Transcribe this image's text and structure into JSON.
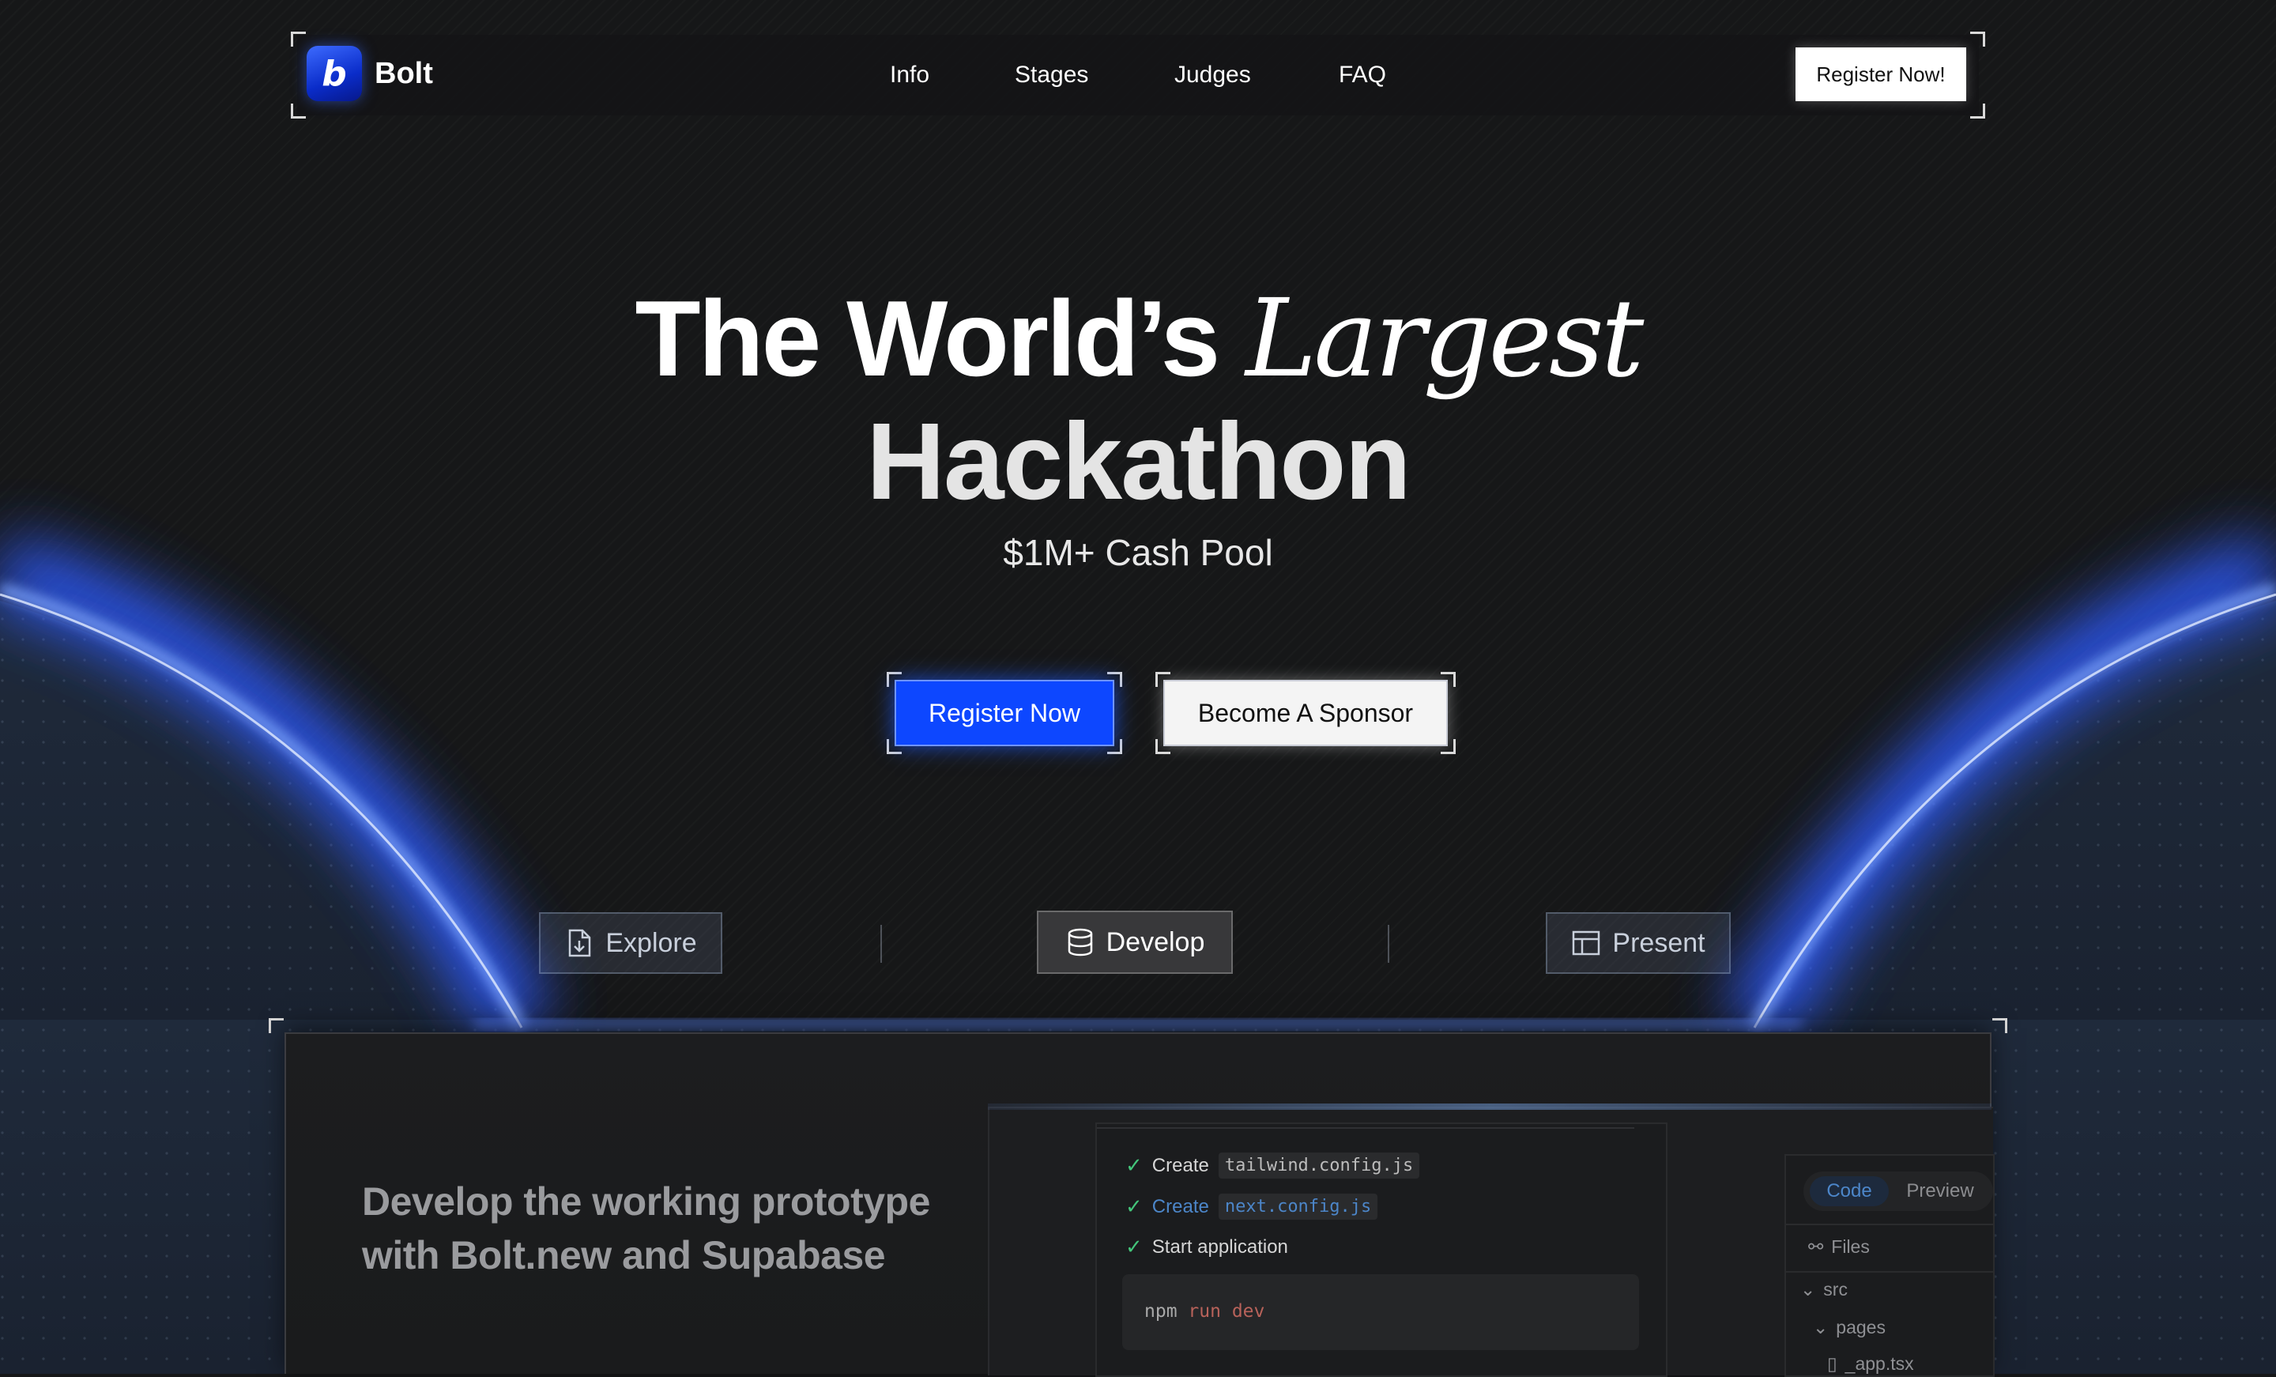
{
  "nav": {
    "brand": "Bolt",
    "logo_letter": "b",
    "links": [
      "Info",
      "Stages",
      "Judges",
      "FAQ"
    ],
    "cta": "Register Now!"
  },
  "hero": {
    "title_prefix": "The World’s",
    "title_italic": "Largest",
    "title_line2": "Hackathon",
    "subtitle": "$1M+ Cash Pool",
    "primary_button": "Register Now",
    "secondary_button": "Become A Sponsor"
  },
  "tabs": [
    {
      "label": "Explore",
      "icon": "file-download-icon"
    },
    {
      "label": "Develop",
      "icon": "database-icon"
    },
    {
      "label": "Present",
      "icon": "layout-icon"
    }
  ],
  "panel": {
    "headline_line1": "Develop the working prototype",
    "headline_line2": "with Bolt.new and Supabase"
  },
  "mock": {
    "steps": [
      {
        "label": "Create",
        "code": "tailwind.config.js"
      },
      {
        "label": "Create",
        "code": "next.config.js"
      },
      {
        "label": "Start application",
        "code": ""
      }
    ],
    "terminal_cmd": "npm",
    "terminal_kw1": "run",
    "terminal_kw2": "dev",
    "toggle_on": "Code",
    "toggle_off": "Preview",
    "files_label": "Files",
    "tree": [
      "src",
      "pages",
      "_app.tsx"
    ]
  },
  "colors": {
    "accent": "#0d47ff",
    "glow": "#3d6bff",
    "background": "#161718",
    "success": "#43c57a",
    "link_blue": "#4c86c9"
  }
}
